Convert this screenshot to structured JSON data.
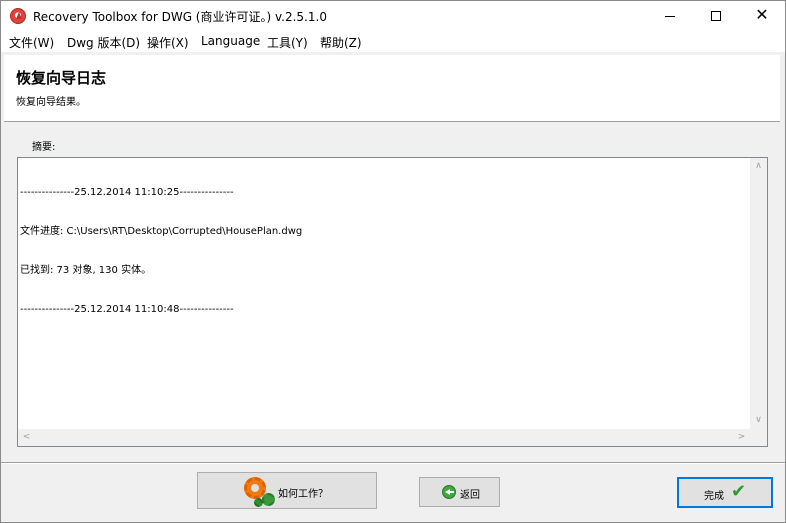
{
  "window": {
    "title": "Recovery Toolbox for DWG (商业许可证。) v.2.5.1.0",
    "minimize_glyph": "",
    "maximize_glyph": "",
    "close_glyph": "✕"
  },
  "menu": {
    "file": "文件(W)",
    "dwg_version": "Dwg 版本(D)",
    "operation": "操作(X)",
    "language": "Language",
    "tools": "工具(Y)",
    "help": "帮助(Z)"
  },
  "header": {
    "title": "恢复向导日志",
    "subtitle": "恢复向导结果。"
  },
  "summary_label": "摘要:",
  "log": {
    "lines": [
      "---------------25.12.2014 11:10:25---------------",
      "文件进度: C:\\Users\\RT\\Desktop\\Corrupted\\HousePlan.dwg",
      "已找到: 73 对象, 130 实体。",
      "---------------25.12.2014 11:10:48---------------"
    ]
  },
  "scroll": {
    "up": "∧",
    "down": "∨",
    "left": "<",
    "right": ">"
  },
  "buttons": {
    "how_it_works": "如何工作？",
    "back": "返回",
    "done": "完成"
  },
  "icons": {
    "app": "app-logo-icon",
    "how_it_works": "gears-icon",
    "back": "back-arrow-icon",
    "done": "checkmark-icon",
    "done_glyph": "✔"
  },
  "colors": {
    "done_border": "#0078d7",
    "gear_orange": "#f07a10",
    "gear_green": "#3a9a3a",
    "check_green": "#2e9a2e"
  }
}
